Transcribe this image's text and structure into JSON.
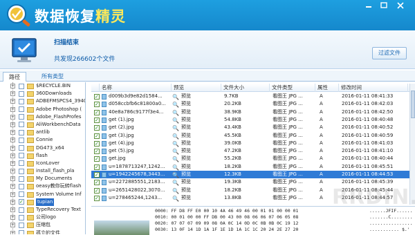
{
  "app": {
    "title_main": "数据恢复",
    "title_accent": "精灵"
  },
  "header": {
    "scan_title": "扫描结束",
    "scan_count": "共发现266602个文件",
    "filter_button": "过滤文件"
  },
  "tabs": [
    "路径",
    "所有类型"
  ],
  "tree": [
    {
      "label": "$RECYCLE.BIN",
      "checked": false
    },
    {
      "label": "360Downloads",
      "checked": false
    },
    {
      "label": "ADBEFMSPCS4_3940?",
      "checked": false
    },
    {
      "label": "Adobe Photoshop (",
      "checked": false
    },
    {
      "label": "Adobe_FlashProfes",
      "checked": false
    },
    {
      "label": "AliWorkbenchData",
      "checked": false
    },
    {
      "label": "antlib",
      "checked": false
    },
    {
      "label": "Connie",
      "checked": false
    },
    {
      "label": "DG473_x64",
      "checked": false
    },
    {
      "label": "flash",
      "checked": false
    },
    {
      "label": "IconLover",
      "checked": false
    },
    {
      "label": "install_flash_pla",
      "checked": false
    },
    {
      "label": "My Documents",
      "checked": false
    },
    {
      "label": "oeasy教你玩转flash",
      "checked": false
    },
    {
      "label": "System Volume Inf",
      "checked": false
    },
    {
      "label": "tupian",
      "checked": true,
      "selected": true
    },
    {
      "label": "TypeRecovery Text",
      "checked": false
    },
    {
      "label": "公司logo",
      "checked": false
    },
    {
      "label": "压缩包",
      "checked": false
    },
    {
      "label": "孤立的文件",
      "checked": false
    },
    {
      "label": "数据恢复精灵",
      "checked": false
    }
  ],
  "columns": [
    "名称",
    "预览",
    "文件大小",
    "文件类型",
    "属性",
    "修改时间"
  ],
  "rows": [
    {
      "name": "d009b3d9e82d1584...",
      "preview": "预览",
      "size": "9.7KB",
      "type": "看图王 JPG ...",
      "attr": "A",
      "time": "2016-01-11 08:41:33"
    },
    {
      "name": "d058ccbfb6c81800a0...",
      "preview": "预览",
      "size": "20.2KB",
      "type": "看图王 JPG ...",
      "attr": "A",
      "time": "2016-01-11 08:42:03"
    },
    {
      "name": "40e8a786c9177f3e4...",
      "preview": "预览",
      "size": "38.9KB",
      "type": "看图王 JPG ...",
      "attr": "A",
      "time": "2016-01-11 08:42:50"
    },
    {
      "name": "get (1).jpg",
      "preview": "预览",
      "size": "54.8KB",
      "type": "看图王 JPG ...",
      "attr": "A",
      "time": "2016-01-11 08:40:48"
    },
    {
      "name": "get (2).jpg",
      "preview": "预览",
      "size": "43.4KB",
      "type": "看图王 JPG ...",
      "attr": "A",
      "time": "2016-01-11 08:40:52"
    },
    {
      "name": "get (3).jpg",
      "preview": "预览",
      "size": "45.5KB",
      "type": "看图王 JPG ...",
      "attr": "A",
      "time": "2016-01-11 08:40:59"
    },
    {
      "name": "get (4).jpg",
      "preview": "预览",
      "size": "39.0KB",
      "type": "看图王 JPG ...",
      "attr": "A",
      "time": "2016-01-11 08:41:03"
    },
    {
      "name": "get (5).jpg",
      "preview": "预览",
      "size": "47.2KB",
      "type": "看图王 JPG ...",
      "attr": "A",
      "time": "2016-01-11 08:41:10"
    },
    {
      "name": "get.jpg",
      "preview": "预览",
      "size": "55.2KB",
      "type": "看图王 JPG ...",
      "attr": "A",
      "time": "2016-01-11 08:40:44"
    },
    {
      "name": "u=1878713247,1242...",
      "preview": "预览",
      "size": "18.2KB",
      "type": "看图王 JPG ...",
      "attr": "A",
      "time": "2016-01-11 08:45:51"
    },
    {
      "name": "u=1942245678,3443...",
      "preview": "预览",
      "size": "12.3KB",
      "type": "看图王 JPG ...",
      "attr": "A",
      "time": "2016-01-11 08:44:53",
      "selected": true
    },
    {
      "name": "u=2272885551,2183...",
      "preview": "预览",
      "size": "19.3KB",
      "type": "看图王 JPG ...",
      "attr": "A",
      "time": "2016-01-11 08:45:39"
    },
    {
      "name": "u=2651428022,3070...",
      "preview": "预览",
      "size": "18.2KB",
      "type": "看图王 JPG ...",
      "attr": "A",
      "time": "2016-01-11 08:45:44"
    },
    {
      "name": "u=278465244,1243...",
      "preview": "预览",
      "size": "13.8KB",
      "type": "看图王 JPG ...",
      "attr": "A",
      "time": "2016-01-11 08:44:57"
    }
  ],
  "hex": [
    {
      "offset": "0000:",
      "bytes": "FF D8 FF E0 00 10 4A 46 49 46 00 01 01 00 00 01",
      "ascii": "......JFIF......"
    },
    {
      "offset": "0010:",
      "bytes": "00 01 00 00 FF DB 00 43 00 08 06 06 07 06 05 08",
      "ascii": ".......C........"
    },
    {
      "offset": "0020:",
      "bytes": "07 07 07 09 09 08 0A 0C 14 0D 0C 0B 0B 0C 19 12",
      "ascii": "................"
    },
    {
      "offset": "0030:",
      "bytes": "13 0F 14 1D 1A 1F 1E 1D 1A 1C 1C 20 24 2E 27 20",
      "ascii": "........... $.' "
    }
  ],
  "watermark": "RRDIN.COM"
}
